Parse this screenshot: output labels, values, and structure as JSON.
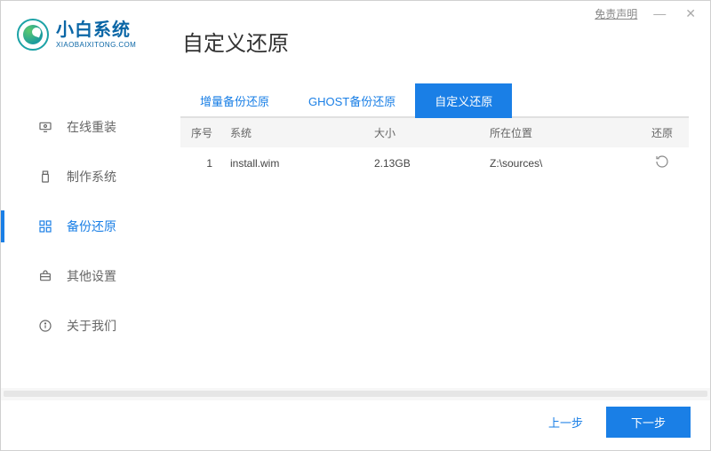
{
  "window": {
    "disclaimer_label": "免责声明"
  },
  "brand": {
    "cn": "小白系统",
    "en": "XIAOBAIXITONG.COM"
  },
  "sidebar": {
    "items": [
      {
        "label": "在线重装"
      },
      {
        "label": "制作系统"
      },
      {
        "label": "备份还原"
      },
      {
        "label": "其他设置"
      },
      {
        "label": "关于我们"
      }
    ],
    "active_index": 2
  },
  "main": {
    "title": "自定义还原",
    "tabs": [
      {
        "label": "增量备份还原"
      },
      {
        "label": "GHOST备份还原"
      },
      {
        "label": "自定义还原"
      }
    ],
    "active_tab_index": 2,
    "table": {
      "headers": {
        "index": "序号",
        "system": "系统",
        "size": "大小",
        "location": "所在位置",
        "restore": "还原"
      },
      "rows": [
        {
          "index": "1",
          "system": "install.wim",
          "size": "2.13GB",
          "location": "Z:\\sources\\"
        }
      ]
    }
  },
  "footer": {
    "prev_label": "上一步",
    "next_label": "下一步"
  },
  "colors": {
    "accent": "#1a7fe6"
  }
}
